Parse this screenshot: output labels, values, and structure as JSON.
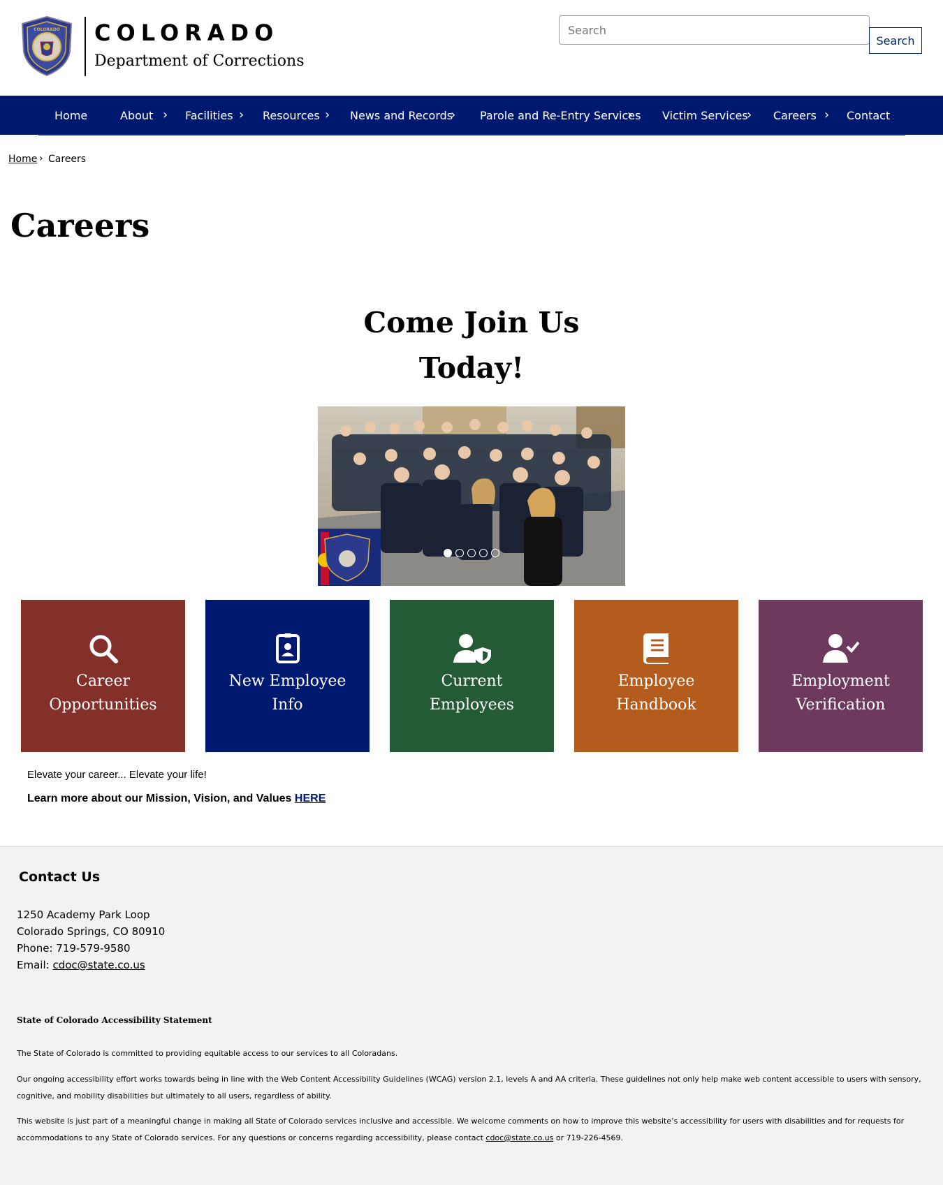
{
  "header": {
    "logo_state": "COLORADO",
    "logo_department": "Department of Corrections",
    "search_placeholder": "Search",
    "search_button": "Search"
  },
  "nav": {
    "items": [
      {
        "label": "Home"
      },
      {
        "label": "About"
      },
      {
        "label": "Facilities"
      },
      {
        "label": "Resources"
      },
      {
        "label": "News and Records"
      },
      {
        "label": "Parole and Re-Entry Services"
      },
      {
        "label": "Victim Services"
      },
      {
        "label": "Careers"
      },
      {
        "label": "Contact"
      }
    ],
    "chevron": "›"
  },
  "breadcrumb": {
    "home": "Home",
    "separator": "›",
    "current": "Careers"
  },
  "page": {
    "title": "Careers",
    "hero_line1": "Come Join Us",
    "hero_line2": "Today!"
  },
  "carousel": {
    "slide_count": 5,
    "active_slide": 1
  },
  "tiles": [
    {
      "line1": "Career",
      "line2": "Opportunities",
      "color": "#84302a",
      "icon": "search-icon"
    },
    {
      "line1": "New Employee",
      "line2": "Info",
      "color": "#001970",
      "icon": "id-badge-icon"
    },
    {
      "line1": "Current",
      "line2": "Employees",
      "color": "#255a37",
      "icon": "user-shield-icon"
    },
    {
      "line1": "Employee",
      "line2": "Handbook",
      "color": "#b45c1e",
      "icon": "book-icon"
    },
    {
      "line1": "Employment",
      "line2": "Verification",
      "color": "#6d3a5e",
      "icon": "user-check-icon"
    }
  ],
  "content": {
    "tagline": "Elevate your career... Elevate your life!",
    "mission_text": "Learn more about our Mission, Vision, and Values ",
    "mission_link": "HERE"
  },
  "footer": {
    "contact_heading": "Contact Us",
    "address_line1": "1250 Academy Park Loop",
    "address_line2": "Colorado Springs, CO 80910",
    "phone": "Phone: 719-579-9580",
    "email_label": "Email: ",
    "email": "cdoc@state.co.us",
    "accessibility_title": "State of Colorado Accessibility Statement",
    "accessibility_p1": "The State of Colorado is committed to providing equitable access to our services to all Coloradans.",
    "accessibility_p2_line1": "Our ongoing accessibility effort works towards being in line with the Web Content Accessibility Guidelines (WCAG) version 2.1, levels A and AA criteria. These guidelines not only help make web content accessible to users with sensory,",
    "accessibility_p2_line2": "cognitive, and mobility disabilities but ultimately to all users, regardless of ability.",
    "accessibility_p3_line1": "This website is just part of a meaningful change in making all State of Colorado services inclusive and accessible. We welcome comments on how to improve this website’s accessibility for users with disabilities and for requests for",
    "accessibility_p3_line2_pre": "accommodations to any State of Colorado services. For any questions or concerns regarding accessibility, please contact ",
    "accessibility_email": "cdoc@state.co.us",
    "accessibility_p3_line2_post": " or 719-226-4569."
  },
  "colors": {
    "nav_bg": "#001970",
    "footer_bg": "#f2f2f2",
    "link": "#001970"
  }
}
